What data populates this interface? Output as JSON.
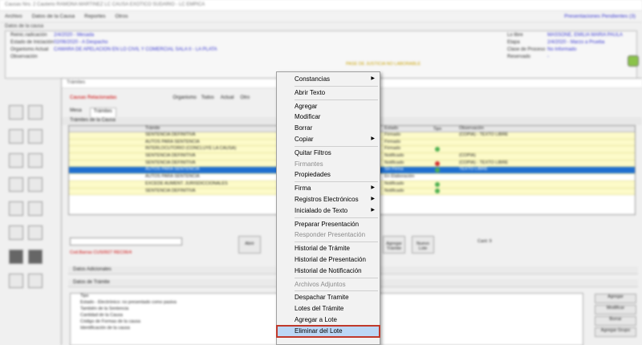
{
  "window": {
    "title": "Causas Nro. 2 Cauterio RAMONA MARTINEZ LC CAUSA EXOTICO SUDARIO - LC EMPICA",
    "menu": [
      "Archivo",
      "Datos de la Causa",
      "Reportes",
      "Otros"
    ],
    "pending_link": "Presentaciones Pendientes (3)"
  },
  "case_data": {
    "section_label": "Datos de la causa",
    "fields_left": [
      {
        "key": "Reinic.radicación",
        "value": "2/4/2020 - Mesada"
      },
      {
        "key": "Estado de Iniciación",
        "value": "02/06/2020 - A Despacho"
      },
      {
        "key": "Organismo Actual",
        "value": "CAMARA DE APELACION EN LO CIVIL Y COMERCIAL SALA II - LA PLATA"
      },
      {
        "key": "Observación",
        "value": ""
      }
    ],
    "fields_right": [
      {
        "key": "Lo libre",
        "value": "MASSONE, EMILIA MARIA PAULA"
      },
      {
        "key": "Etapa",
        "value": "2/4/2020 - Marzo a Prueba"
      },
      {
        "key": "Clase de Proceso",
        "value": "No Informado"
      },
      {
        "key": "Reservado",
        "value": "-"
      }
    ],
    "deadline_note": "PASE DE JUSTICIA NO LABORABLE"
  },
  "tramites": {
    "title": "Trámites",
    "related_label": "Causas Relacionadas",
    "organism_label": "Organismo",
    "organism_options": [
      "Todos",
      "Actual",
      "Otro"
    ],
    "tabs": [
      "Mesa",
      "Trámites"
    ],
    "grid_title": "Trámites de la Causa",
    "columns": {
      "icons": "",
      "desc": "Trámite",
      "state": "Estado",
      "type": "Tipo",
      "obs": "Observación"
    },
    "rows": [
      {
        "desc": "SENTENCIA DEFINITIVA",
        "state": "Firmado",
        "dot": "",
        "obs": "(COPIA) - TEXTO LIBRE",
        "style": "yellow"
      },
      {
        "desc": "AUTOS PARA SENTENCIA",
        "state": "Firmado",
        "dot": "",
        "obs": "",
        "style": "yellow"
      },
      {
        "desc": "INTERLOCUTORIO (CONCLUYE LA CAUSA)",
        "state": "Firmado",
        "dot": "g",
        "obs": "",
        "style": "yellow"
      },
      {
        "desc": "SENTENCIA DEFINITIVA",
        "state": "Notificado",
        "dot": "",
        "obs": "(COPIA)",
        "style": "yellow"
      },
      {
        "desc": "SENTENCIA DEFINITIVA",
        "state": "Notificado",
        "dot": "r",
        "obs": "(COPIA) - TEXTO LIBRE",
        "style": "yellow"
      },
      {
        "desc": "AUTOS PARA SENTENCIA",
        "state": "Sin Firma",
        "dot": "g",
        "obs": "TEXTO LIBRE",
        "style": "sel"
      },
      {
        "desc": "AUTOS PARA SENTENCIA",
        "state": "En Elaboración",
        "dot": "",
        "obs": "",
        "style": "plain"
      },
      {
        "desc": "EXCEDE AUMENT. JURISDICCIONALES",
        "state": "Notificado",
        "dot": "g",
        "obs": "",
        "style": "yellow"
      },
      {
        "desc": "SENTENCIA DEFINITIVA",
        "state": "Notificado",
        "dot": "g",
        "obs": "",
        "style": "yellow"
      }
    ],
    "lower": {
      "red_label": "Cod.Barras",
      "barcode_value": "CUS0927 REC06/4",
      "buttons": [
        "Abrir",
        "Agregar Trámite",
        "Nuevo Lote"
      ],
      "count": "Cant: 9"
    },
    "sections": [
      "Datos Adicionales",
      "Datos de Trámite"
    ],
    "detail_list": [
      "Tipo",
      "Estado - Electrónico: no presentado como pasiva",
      "También de la Sentencia",
      "Cantidad de la Causa",
      "Código de Formas de la causa",
      "Identificación de la causa"
    ],
    "detail_buttons": [
      "Agregar",
      "Modificar",
      "Borrar",
      "Agregar Grupo"
    ]
  },
  "context_menu": {
    "items": [
      {
        "label": "Constancias",
        "submenu": true,
        "disabled": false
      },
      {
        "sep": true
      },
      {
        "label": "Abrir Texto",
        "submenu": false,
        "disabled": false
      },
      {
        "sep": true
      },
      {
        "label": "Agregar",
        "submenu": false,
        "disabled": false
      },
      {
        "label": "Modificar",
        "submenu": false,
        "disabled": false
      },
      {
        "label": "Borrar",
        "submenu": false,
        "disabled": false
      },
      {
        "label": "Copiar",
        "submenu": true,
        "disabled": false
      },
      {
        "sep": true
      },
      {
        "label": "Quitar Filtros",
        "submenu": false,
        "disabled": false
      },
      {
        "label": "Firmantes",
        "submenu": false,
        "disabled": true
      },
      {
        "label": "Propiedades",
        "submenu": false,
        "disabled": false
      },
      {
        "sep": true
      },
      {
        "label": "Firma",
        "submenu": true,
        "disabled": false
      },
      {
        "label": "Registros Electrónicos",
        "submenu": true,
        "disabled": false
      },
      {
        "label": "Inicialado de Texto",
        "submenu": true,
        "disabled": false
      },
      {
        "sep": true
      },
      {
        "label": "Preparar Presentación",
        "submenu": false,
        "disabled": false
      },
      {
        "label": "Responder Presentación",
        "submenu": false,
        "disabled": true
      },
      {
        "sep": true
      },
      {
        "label": "Historial de Trámite",
        "submenu": false,
        "disabled": false
      },
      {
        "label": "Historial de Presentación",
        "submenu": false,
        "disabled": false
      },
      {
        "label": "Historial de Notificación",
        "submenu": false,
        "disabled": false
      },
      {
        "sep": true
      },
      {
        "label": "Archivos Adjuntos",
        "submenu": false,
        "disabled": true
      },
      {
        "sep": true
      },
      {
        "label": "Despachar Tramite",
        "submenu": false,
        "disabled": false
      },
      {
        "label": "Lotes del Trámite",
        "submenu": false,
        "disabled": false
      },
      {
        "label": "Agregar a Lote",
        "submenu": false,
        "disabled": false
      },
      {
        "label": "Eliminar del Lote",
        "submenu": false,
        "disabled": false,
        "highlighted": true
      }
    ],
    "submenu_arrow": "▶"
  }
}
